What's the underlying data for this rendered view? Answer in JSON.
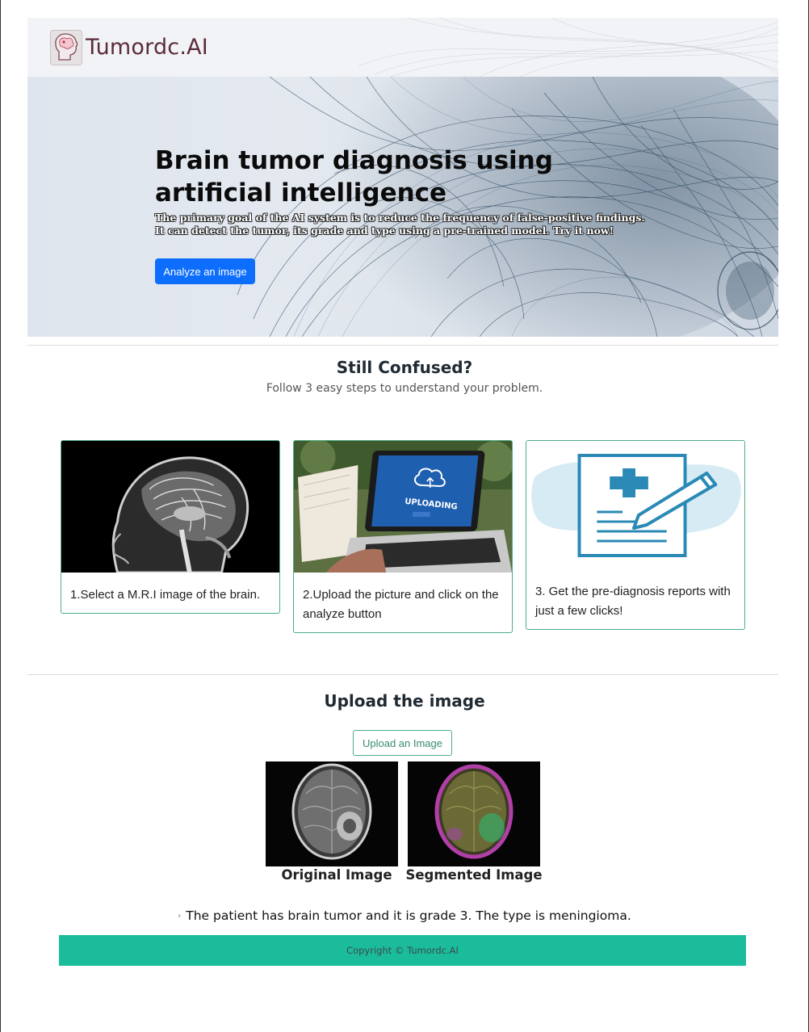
{
  "brand": {
    "name": "Tumordc.AI",
    "logo_icon": "brain-head-icon"
  },
  "hero": {
    "title": "Brain tumor diagnosis using artificial intelligence",
    "subtitle": "The primary goal of the AI system is to reduce the frequency of false-positive findings. It can detect the tumor, its grade and type using a pre-trained model. Try it now!",
    "cta_label": "Analyze an image"
  },
  "steps": {
    "title": "Still Confused?",
    "subtitle": "Follow 3 easy steps to understand your problem.",
    "cards": [
      {
        "text": "1.Select a M.R.I image of the brain.",
        "image": "mri-sagittal-brain"
      },
      {
        "text": "2.Upload the picture and click on the analyze button",
        "image": "laptop-uploading"
      },
      {
        "text": "3. Get the pre-diagnosis reports with just a few clicks!",
        "image": "medical-report-icon"
      }
    ]
  },
  "upload": {
    "title": "Upload the image",
    "button_label": "Upload an Image",
    "original_caption": "Original Image",
    "segmented_caption": "Segmented Image",
    "result_text": "The patient has brain tumor and it is grade 3. The type is meningioma."
  },
  "footer": {
    "copyright": "Copyright © Tumordc.AI"
  },
  "colors": {
    "primary": "#0d6efd",
    "accent_green": "#4cae86",
    "footer_bg": "#1abc9c",
    "brand_text": "#5b2c3a"
  }
}
